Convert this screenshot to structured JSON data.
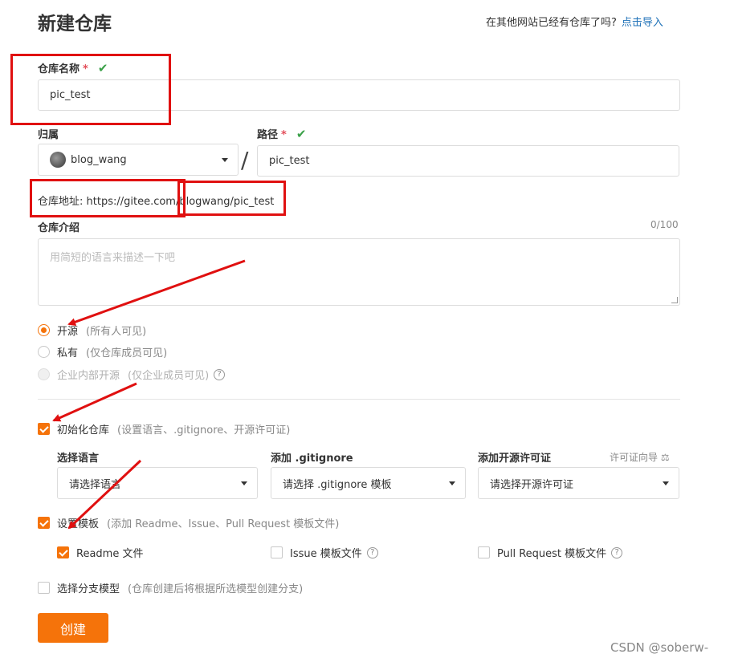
{
  "header": {
    "title": "新建仓库",
    "import_hint": "在其他网站已经有仓库了吗?",
    "import_link": "点击导入"
  },
  "repo_name": {
    "label": "仓库名称",
    "required_mark": "*",
    "value": "pic_test"
  },
  "owner": {
    "label": "归属",
    "value": "blog_wang"
  },
  "path": {
    "label": "路径",
    "required_mark": "*",
    "value": "pic_test"
  },
  "repo_url": {
    "text": "仓库地址:  https://gitee.com/blogwang/pic_test"
  },
  "description": {
    "label": "仓库介绍",
    "counter": "0/100",
    "placeholder": "用简短的语言来描述一下吧"
  },
  "visibility": {
    "options": [
      {
        "label": "开源",
        "note": "(所有人可见)",
        "selected": true,
        "disabled": false
      },
      {
        "label": "私有",
        "note": "(仅仓库成员可见)",
        "selected": false,
        "disabled": false
      },
      {
        "label": "企业内部开源",
        "note": "(仅企业成员可见)",
        "selected": false,
        "disabled": true
      }
    ]
  },
  "init_repo": {
    "label": "初始化仓库",
    "note": "(设置语言、.gitignore、开源许可证)",
    "checked": true,
    "language": {
      "label": "选择语言",
      "value": "请选择语言"
    },
    "gitignore": {
      "label": "添加 .gitignore",
      "value": "请选择 .gitignore 模板"
    },
    "license": {
      "label": "添加开源许可证",
      "value": "请选择开源许可证",
      "guide": "许可证向导"
    }
  },
  "templates": {
    "label": "设置模板",
    "note": "(添加 Readme、Issue、Pull Request 模板文件)",
    "checked": true,
    "readme": {
      "label": "Readme 文件",
      "checked": true
    },
    "issue": {
      "label": "Issue 模板文件",
      "checked": false
    },
    "pull_request": {
      "label": "Pull Request 模板文件",
      "checked": false
    }
  },
  "branch_model": {
    "label": "选择分支模型",
    "note": "(仓库创建后将根据所选模型创建分支)",
    "checked": false
  },
  "create_button": "创建",
  "watermark": "CSDN @soberw-",
  "colors": {
    "accent": "#f5730a",
    "link": "#1f72b8",
    "success": "#39a047",
    "annotation_red": "#e01010"
  }
}
